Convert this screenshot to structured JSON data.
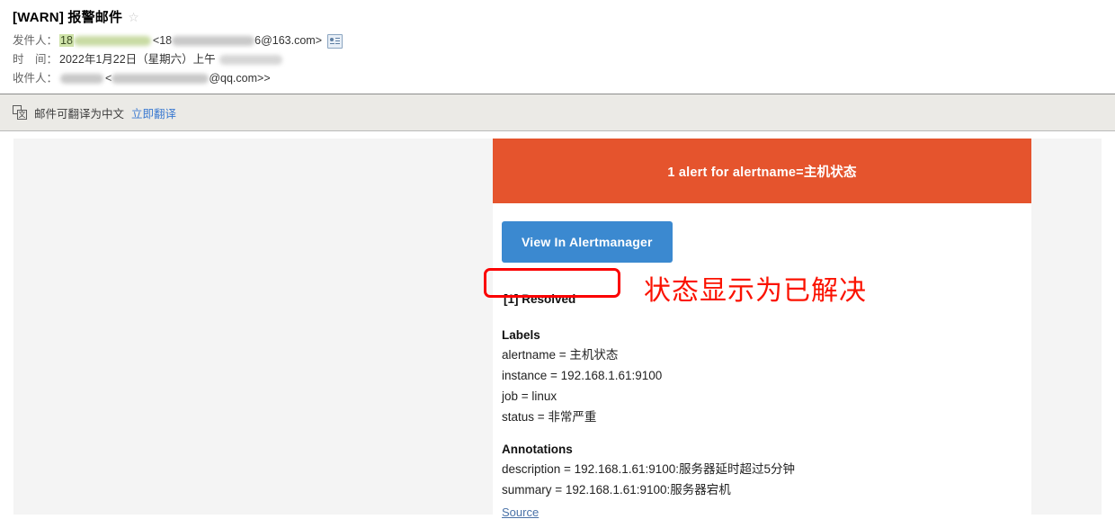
{
  "mail": {
    "subject": "[WARN] 报警邮件",
    "star_icon": "star-outline-icon",
    "fields": {
      "from_label": "发件人：",
      "from_value_prefix": "18",
      "from_value_suffix": "6@163.com>",
      "from_bracket_open": "<18",
      "contact_icon": "contact-card-icon",
      "date_label": "时　间：",
      "date_value": "2022年1月22日（星期六）上午",
      "to_label": "收件人：",
      "to_value_suffix": "@qq.com>"
    }
  },
  "translate_bar": {
    "icon": "translate-icon",
    "icon_glyph": "文",
    "message": "邮件可翻译为中文",
    "link_label": "立即翻译"
  },
  "alert": {
    "banner_title": "1 alert for alertname=主机状态",
    "view_button_label": "View In Alertmanager",
    "status_label": "[1] Resolved",
    "labels_heading": "Labels",
    "labels": [
      "alertname = 主机状态",
      "instance = 192.168.1.61:9100",
      "job = linux",
      "status = 非常严重"
    ],
    "annotations_heading": "Annotations",
    "annotations": [
      "description = 192.168.1.61:9100:服务器延时超过5分钟",
      "summary = 192.168.1.61:9100:服务器宕机"
    ],
    "source_link_label": "Source"
  },
  "markup": {
    "note_text": "状态显示为已解决",
    "highlight_color": "#fb1200"
  },
  "colors": {
    "banner_orange": "#e5542d",
    "button_blue": "#3b89d0",
    "annotation_red": "#fb1200",
    "link_blue": "#3b7ad1",
    "body_gray": "#f4f4f4",
    "bar_gray": "#ebeae6"
  }
}
